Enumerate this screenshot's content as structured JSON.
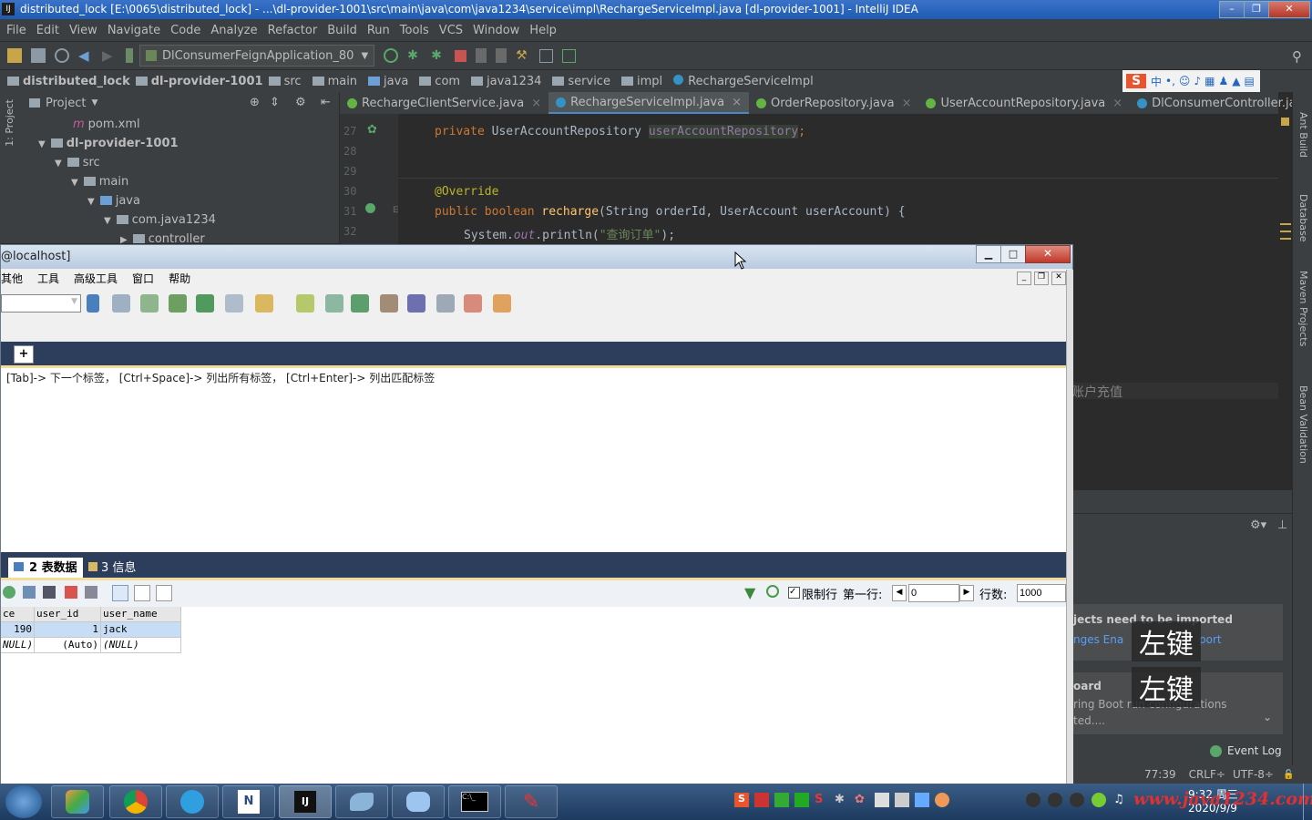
{
  "ide": {
    "title": "distributed_lock [E:\\0065\\distributed_lock] - ...\\dl-provider-1001\\src\\main\\java\\com\\java1234\\service\\impl\\RechargeServiceImpl.java [dl-provider-1001] - IntelliJ IDEA",
    "menu": [
      "File",
      "Edit",
      "View",
      "Navigate",
      "Code",
      "Analyze",
      "Refactor",
      "Build",
      "Run",
      "Tools",
      "VCS",
      "Window",
      "Help"
    ],
    "run_config": "DlConsumerFeignApplication_80",
    "breadcrumbs": [
      "distributed_lock",
      "dl-provider-1001",
      "src",
      "main",
      "java",
      "com",
      "java1234",
      "service",
      "impl",
      "RechargeServiceImpl"
    ],
    "project_panel": {
      "title": "Project",
      "side_label": "1: Project",
      "tree": [
        {
          "label": "pom.xml",
          "indent": 0
        },
        {
          "label": "dl-provider-1001",
          "indent": 1
        },
        {
          "label": "src",
          "indent": 2
        },
        {
          "label": "main",
          "indent": 3
        },
        {
          "label": "java",
          "indent": 4
        },
        {
          "label": "com.java1234",
          "indent": 5
        },
        {
          "label": "controller",
          "indent": 6
        }
      ]
    },
    "tabs": [
      {
        "label": "RechargeClientService.java",
        "active": false,
        "color": "#62b543"
      },
      {
        "label": "RechargeServiceImpl.java",
        "active": true,
        "color": "#3592c4"
      },
      {
        "label": "OrderRepository.java",
        "active": false,
        "color": "#62b543"
      },
      {
        "label": "UserAccountRepository.java",
        "active": false,
        "color": "#62b543"
      },
      {
        "label": "DlConsumerController.java",
        "active": false,
        "color": "#3592c4"
      }
    ],
    "code": {
      "line_numbers": [
        "27",
        "28",
        "29",
        "30",
        "31",
        "32"
      ],
      "l27_kw": "private",
      "l27_type": "UserAccountRepository",
      "l27_field": "userAccountRepository",
      "l27_end": ";",
      "l30_annot": "@Override",
      "l31_kw": "public boolean",
      "l31_fn": "recharge",
      "l31_params": "(String orderId, UserAccount userAccount) {",
      "l32_pre": "System.",
      "l32_out": "out",
      "l32_mid": ".println(",
      "l32_str": "\"查询订单\"",
      "l32_end": ");"
    },
    "right_tools": [
      "Ant Build",
      "Database",
      "Maven Projects",
      "Bean Validation"
    ],
    "partial_comment": "账户充值",
    "notification": {
      "title": "jects need to be imported",
      "links": "nges    Ena",
      "link2": "port",
      "title2": "oard",
      "body2": "ring Boot run configurations",
      "body3": "ted...."
    },
    "event_log": "Event Log",
    "status": {
      "pos": "77:39",
      "crlf": "CRLF÷",
      "enc": "UTF-8÷"
    }
  },
  "sqlyog": {
    "title": "@localhost]",
    "menu": [
      "其他",
      "工具",
      "高级工具",
      "窗口",
      "帮助"
    ],
    "add_tab": "+",
    "hint": "[Tab]-> 下一个标签， [Ctrl+Space]-> 列出所有标签， [Ctrl+Enter]-> 列出匹配标签",
    "result_tabs": [
      {
        "label": "2 表数据",
        "active": true
      },
      {
        "label": "3 信息",
        "active": false
      }
    ],
    "limit_rows_label": "限制行",
    "first_row_label": "第一行:",
    "first_row_value": "0",
    "row_count_label": "行数:",
    "row_count_value": "1000",
    "columns": [
      "ce",
      "user_id",
      "user_name"
    ],
    "rows": [
      [
        "190",
        "1",
        "jack"
      ],
      [
        "NULL)",
        "(Auto)",
        "(NULL)"
      ]
    ]
  },
  "overlays": [
    "左键",
    "左键"
  ],
  "taskbar": {
    "time": "9:32 周三",
    "date": "2020/9/9",
    "watermark": "www.java1234.com"
  }
}
